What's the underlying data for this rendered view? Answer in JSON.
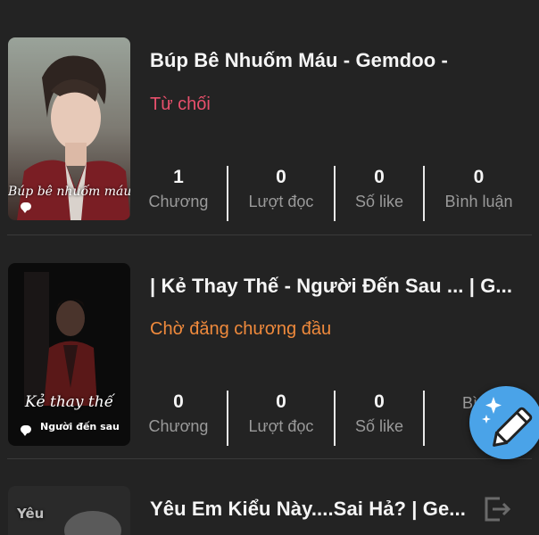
{
  "stories": [
    {
      "title": "Búp Bê Nhuốm Máu - Gemdoo -",
      "status": "Từ chối",
      "status_color": "#e8506c",
      "cover_text": "Búp bê nhuốm máu",
      "cover_sub": "",
      "stats": [
        {
          "value": "1",
          "label": "Chương"
        },
        {
          "value": "0",
          "label": "Lượt đọc"
        },
        {
          "value": "0",
          "label": "Số like"
        },
        {
          "value": "0",
          "label": "Bình luận"
        }
      ]
    },
    {
      "title": "| Kẻ Thay Thế - Người Đến Sau ... | G...",
      "status": "Chờ đăng chương đầu",
      "status_color": "#f08a3c",
      "cover_text": "Kẻ thay thế",
      "cover_sub": "Người đến sau",
      "stats": [
        {
          "value": "0",
          "label": "Chương"
        },
        {
          "value": "0",
          "label": "Lượt đọc"
        },
        {
          "value": "0",
          "label": "Số like"
        },
        {
          "value": "",
          "label": "Bình"
        }
      ]
    },
    {
      "title": "Yêu Em Kiểu Này....Sai Hả? | Ge...",
      "cover_text": "Yêu"
    }
  ],
  "fab": {
    "icon": "edit-pen-sparkle-icon",
    "color": "#4aa3e8"
  },
  "exit_icon": "exit-icon"
}
